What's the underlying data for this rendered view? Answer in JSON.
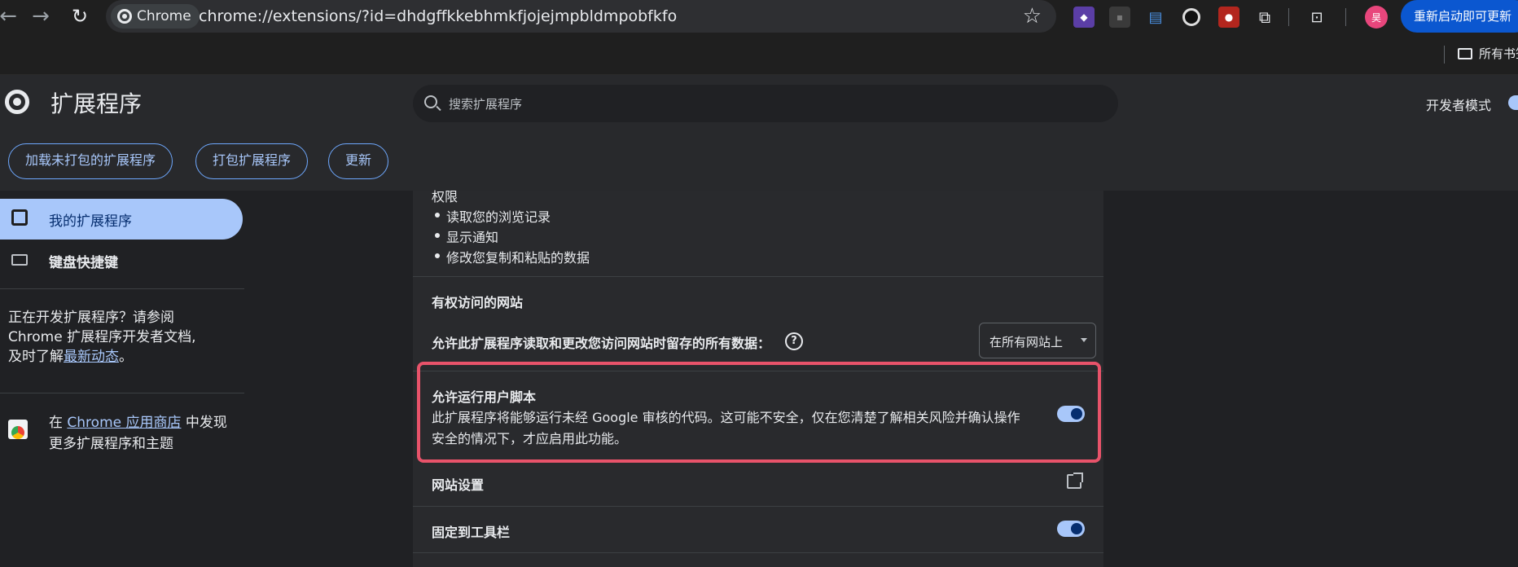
{
  "browser": {
    "site_chip": "Chrome",
    "url": "chrome://extensions/?id=dhdgffkkebhmkfjojejmpbldmpobfkfo",
    "restart_button": "重新启动即可更新",
    "avatar_text": "昊",
    "bookmark_folder": "所有书签",
    "extension_icons": [
      "puzzle-extension-icon",
      "generic-extension-icon",
      "blue-extension-icon",
      "record-extension-icon",
      "red-extension-icon",
      "extensions-puzzle-icon",
      "tab-search-icon"
    ]
  },
  "header": {
    "title": "扩展程序",
    "search_placeholder": "搜索扩展程序",
    "dev_mode_label": "开发者模式",
    "buttons": {
      "load_unpacked": "加载未打包的扩展程序",
      "pack": "打包扩展程序",
      "update": "更新"
    }
  },
  "sidebar": {
    "my_extensions": "我的扩展程序",
    "keyboard_shortcuts": "键盘快捷键",
    "dev_text_1": "正在开发扩展程序？请参阅",
    "dev_text_2": "Chrome 扩展程序开发者文档,",
    "dev_text_3": "及时了解",
    "dev_link": "最新动态",
    "dev_text_4": "。",
    "store_prefix": "在",
    "store_link": "Chrome 应用商店",
    "store_suffix": "中发现更多扩展程序和主题"
  },
  "details": {
    "permissions_title": "权限",
    "permissions": [
      "读取您的浏览记录",
      "显示通知",
      "修改您复制和粘贴的数据"
    ],
    "site_access_title": "有权访问的网站",
    "site_access_label": "允许此扩展程序读取和更改您访问网站时留存的所有数据：",
    "site_access_value": "在所有网站上",
    "user_scripts_title": "允许运行用户脚本",
    "user_scripts_desc_1": "此扩展程序将能够运行未经 Google 审核的代码。这可能不安全，仅在您清楚了解相关风险并确认操作",
    "user_scripts_desc_2": "安全的情况下，才应启用此功能。",
    "site_settings": "网站设置",
    "pin_toolbar": "固定到工具栏"
  },
  "colors": {
    "accent": "#a8c7fa",
    "highlight": "#e8536a",
    "background": "#202124",
    "card": "#292a2d"
  }
}
